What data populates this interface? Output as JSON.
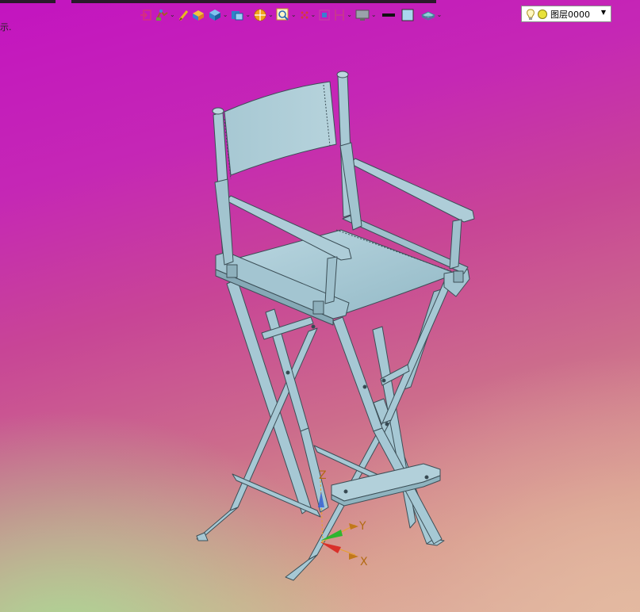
{
  "window": {
    "left_label": "示."
  },
  "toolbar": {
    "tools": [
      {
        "icon": "exit-sketch-icon",
        "dropdown": false
      },
      {
        "icon": "move-object-icon",
        "dropdown": true
      },
      {
        "icon": "pen-icon",
        "dropdown": false
      },
      {
        "icon": "render-shaded-icon",
        "dropdown": false
      },
      {
        "icon": "box-view-icon",
        "dropdown": true
      },
      {
        "icon": "display-mode-icon",
        "dropdown": true
      },
      {
        "icon": "orient-view-icon",
        "dropdown": true
      },
      {
        "icon": "zoom-icon",
        "dropdown": true
      },
      {
        "icon": "snap-points-icon",
        "dropdown": true
      },
      {
        "icon": "fit-view-icon",
        "dropdown": false
      },
      {
        "icon": "section-view-icon",
        "dropdown": true
      },
      {
        "icon": "background-display-icon",
        "dropdown": true
      },
      {
        "icon": "line-color-icon",
        "dropdown": false
      },
      {
        "icon": "fill-color-icon",
        "dropdown": false
      },
      {
        "icon": "layer-tools-icon",
        "dropdown": true
      }
    ],
    "colors": {
      "line_color": "#111111",
      "fill_color": "#a9d6ee"
    }
  },
  "layer": {
    "selected": "图层0000",
    "light_on": true
  },
  "viewport": {
    "background_top": "#c314c0",
    "background_bottom_left": "#a5e196",
    "background_bottom_right": "#e4b9a0",
    "model_color": "#a6c8d4",
    "triad": {
      "x_label": "X",
      "y_label": "Y",
      "z_label": "Z"
    }
  }
}
